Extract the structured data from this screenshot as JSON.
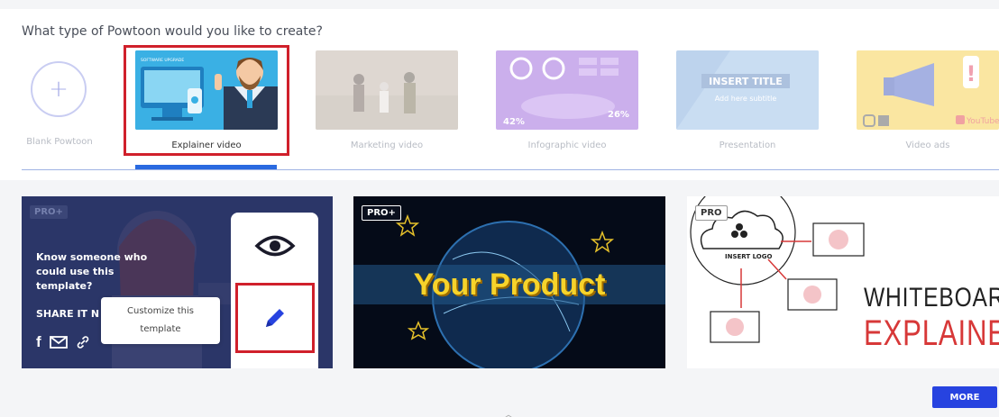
{
  "prompt": "What type of Powtoon would you like to create?",
  "types": [
    {
      "label": "Blank Powtoon"
    },
    {
      "label": "Explainer video"
    },
    {
      "label": "Marketing video"
    },
    {
      "label": "Infographic video"
    },
    {
      "label": "Presentation"
    },
    {
      "label": "Video ads"
    }
  ],
  "selected_type": "Explainer video",
  "thumb_text": {
    "explainer_banner": "SOFTWARE UPGRADE",
    "infographic_pct1": "42%",
    "infographic_pct2": "26%",
    "presentation_title": "INSERT TITLE",
    "presentation_subtitle": "Add here subtitle",
    "video_ads_brand": "YouTube"
  },
  "cards": [
    {
      "badge": "PRO+",
      "share_prompt": "Know someone who could use this template?",
      "share_it": "SHARE IT N",
      "tooltip_line1": "Customize this",
      "tooltip_line2": "template"
    },
    {
      "badge": "PRO+",
      "headline": "Your Product"
    },
    {
      "badge": "PRO",
      "logo_text": "INSERT LOGO",
      "title_line1": "WHITEBOARD",
      "title_line2": "EXPLAINER"
    }
  ],
  "more_label": "MORE",
  "colors": {
    "accent": "#2743e0",
    "selection": "#d0202b",
    "tab_underline": "#2a6ae0"
  }
}
